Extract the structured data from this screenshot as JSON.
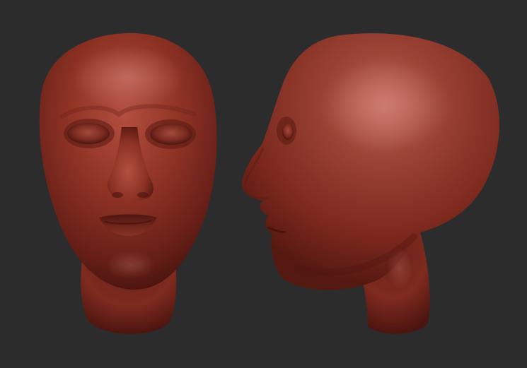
{
  "scene": {
    "background_color": "#2c2c2c",
    "material_color": "#8a2f22",
    "material_shadow_color": "#4a140f",
    "material_highlight_color": "#c0655a",
    "objects": [
      {
        "name": "head-front-view",
        "view": "front"
      },
      {
        "name": "head-side-view",
        "view": "profile-left"
      }
    ]
  }
}
